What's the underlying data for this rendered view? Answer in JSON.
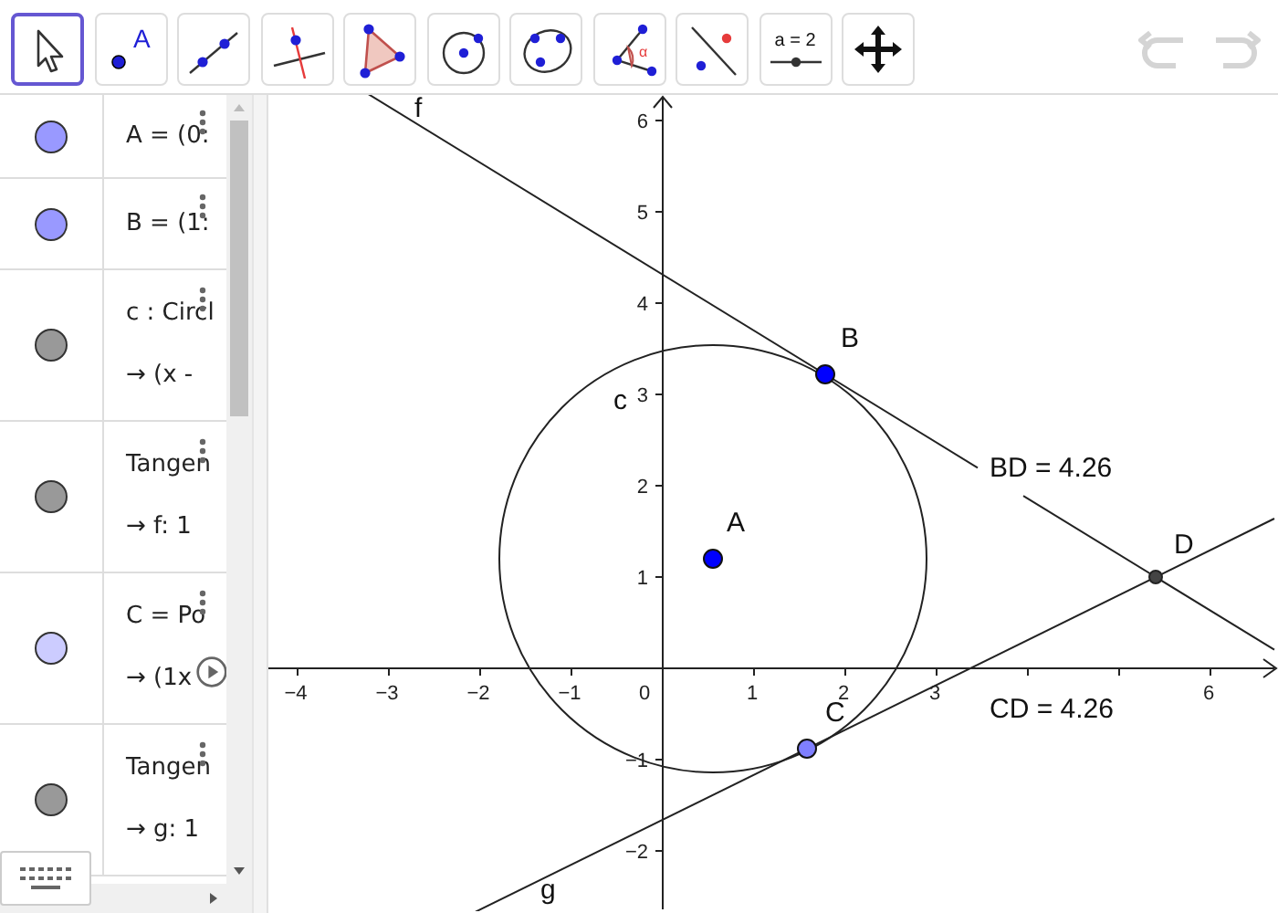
{
  "toolbar": {
    "tools": [
      {
        "kind": "move",
        "selected": true
      },
      {
        "kind": "point",
        "selected": false,
        "glyph": "A"
      },
      {
        "kind": "line",
        "selected": false
      },
      {
        "kind": "perpendicular",
        "selected": false
      },
      {
        "kind": "polygon",
        "selected": false
      },
      {
        "kind": "circle",
        "selected": false
      },
      {
        "kind": "conic",
        "selected": false
      },
      {
        "kind": "angle",
        "selected": false,
        "glyph": "α"
      },
      {
        "kind": "reflect",
        "selected": false
      },
      {
        "kind": "slider",
        "selected": false,
        "label": "a = 2"
      },
      {
        "kind": "move_view",
        "selected": false
      }
    ],
    "undo": {
      "disabled": true
    },
    "redo": {
      "disabled": true
    }
  },
  "algebra": {
    "items": [
      {
        "color": "#9999ff",
        "lines": [
          "A = (0:"
        ],
        "animated": false
      },
      {
        "color": "#9999ff",
        "lines": [
          "B = (1:"
        ],
        "animated": false
      },
      {
        "color": "#999999",
        "lines": [
          "c : Circl",
          "→  (x -"
        ],
        "animated": false
      },
      {
        "color": "#999999",
        "lines": [
          "Tangen",
          "→  f: 1"
        ],
        "animated": false
      },
      {
        "color": "#ccccff",
        "lines": [
          "C = Po",
          "→  (1x"
        ],
        "animated": true
      },
      {
        "color": "#999999",
        "lines": [
          "Tangen",
          "→  g: 1"
        ],
        "animated": false
      }
    ]
  },
  "graphics": {
    "x_ticks": [
      "−4",
      "−3",
      "−2",
      "−1",
      "1",
      "2",
      "3",
      "6"
    ],
    "origin": "0",
    "y_ticks": [
      "6",
      "5",
      "4",
      "3",
      "2",
      "1",
      "−1",
      "−2"
    ],
    "circle": {
      "label": "c"
    },
    "lines": [
      {
        "label": "f"
      },
      {
        "label": "g"
      }
    ],
    "points": [
      {
        "label": "A",
        "color": "#0000ff"
      },
      {
        "label": "B",
        "color": "#0000ff"
      },
      {
        "label": "C",
        "color": "#7f7fff"
      },
      {
        "label": "D",
        "color": "#444444"
      }
    ],
    "measures": [
      "BD = 4.26",
      "CD = 4.26"
    ]
  }
}
